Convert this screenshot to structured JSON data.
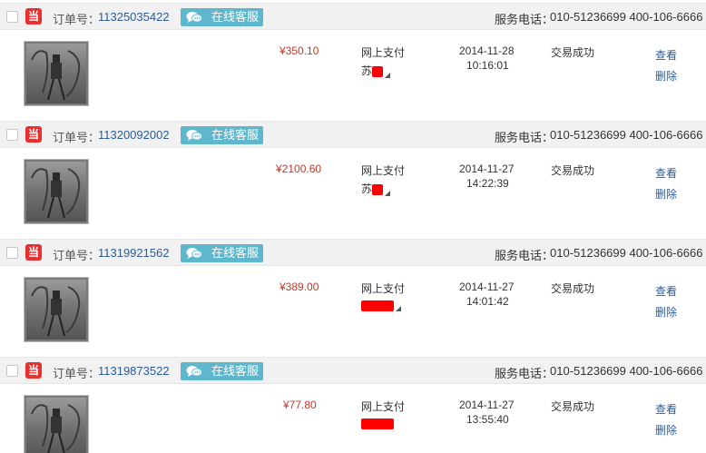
{
  "labels": {
    "order_no": "订单号：",
    "customer_service": "在线客服",
    "phone_label": "服务电话：",
    "phone": "010-51236699 400-106-6666",
    "view": "查看",
    "delete": "删除",
    "shop_icon_glyph": "当"
  },
  "colors": {
    "header_bg": "#f1f1f1",
    "shop_icon": "#e8302f",
    "cs_button": "#5eb7cd",
    "link": "#2a5c96",
    "price": "#c0392b",
    "redaction": "#ff0000"
  },
  "orders": [
    {
      "order_no": "11325035422",
      "price": "¥350.10",
      "pay_method": "网上支付",
      "buyer_prefix": "苏",
      "date": "2014-11-28",
      "time": "10:16:01",
      "status": "交易成功"
    },
    {
      "order_no": "11320092002",
      "price": "¥2100.60",
      "pay_method": "网上支付",
      "buyer_prefix": "苏",
      "date": "2014-11-27",
      "time": "14:22:39",
      "status": "交易成功"
    },
    {
      "order_no": "11319921562",
      "price": "¥389.00",
      "pay_method": "网上支付",
      "buyer_prefix": "",
      "date": "2014-11-27",
      "time": "14:01:42",
      "status": "交易成功"
    },
    {
      "order_no": "11319873522",
      "price": "¥77.80",
      "pay_method": "网上支付",
      "buyer_prefix": "",
      "date": "2014-11-27",
      "time": "13:55:40",
      "status": "交易成功"
    }
  ]
}
